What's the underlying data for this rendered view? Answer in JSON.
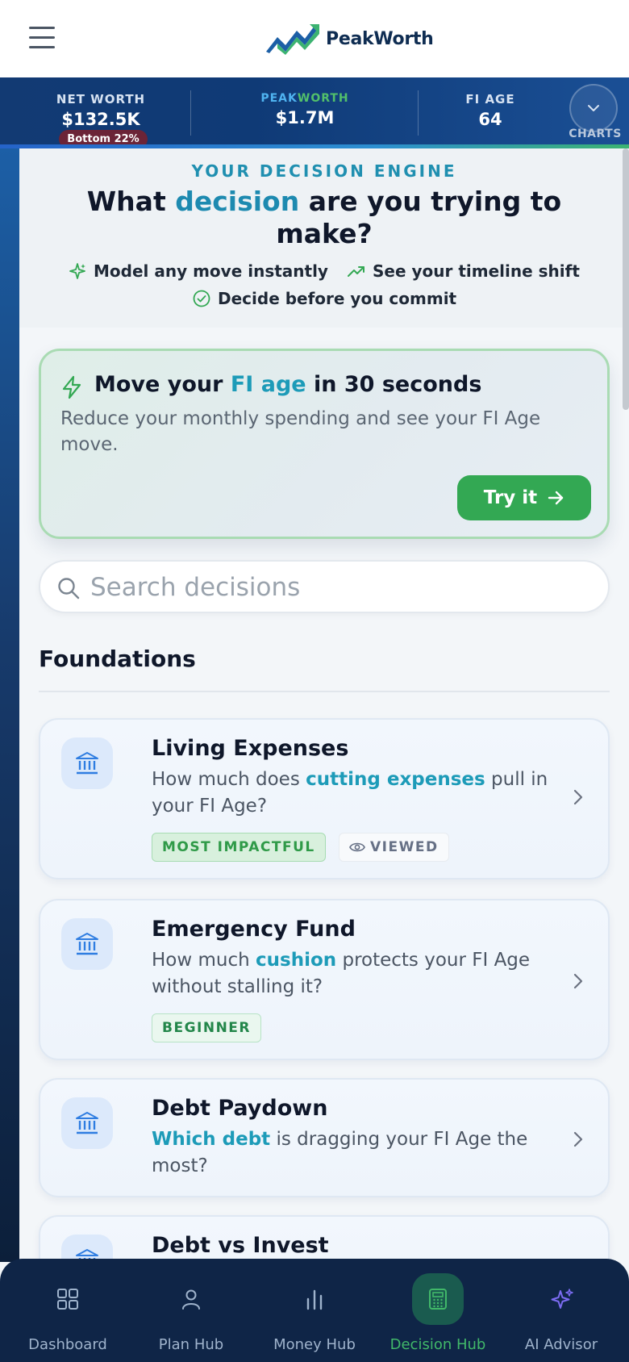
{
  "header": {
    "brand": "PeakWorth"
  },
  "stats": {
    "net_worth_label": "NET WORTH",
    "net_worth_value": "$132.5K",
    "net_worth_badge": "Bottom 22%",
    "peakworth_label_peak": "PEAK",
    "peakworth_label_worth": "WORTH",
    "peakworth_value": "$1.7M",
    "fi_age_label": "FI AGE",
    "fi_age_value": "64",
    "charts_label": "CHARTS"
  },
  "hero": {
    "eyebrow": "YOUR DECISION ENGINE",
    "headline_pre": "What ",
    "headline_accent": "decision",
    "headline_post": " are you trying to make?",
    "features": [
      "Model any move instantly",
      "See your timeline shift",
      "Decide before you commit"
    ]
  },
  "promo": {
    "title_pre": "Move your ",
    "title_accent": "FI age",
    "title_post": " in 30 seconds",
    "description": "Reduce your monthly spending and see your FI Age move.",
    "button_label": "Try it"
  },
  "search": {
    "placeholder": "Search decisions"
  },
  "section": {
    "title": "Foundations"
  },
  "cards": [
    {
      "title": "Living Expenses",
      "desc_pre": "How much does ",
      "desc_hl": "cutting expenses",
      "desc_post": " pull in your FI Age?",
      "tags": [
        "MOST IMPACTFUL",
        "VIEWED"
      ]
    },
    {
      "title": "Emergency Fund",
      "desc_pre": "How much ",
      "desc_hl": "cushion",
      "desc_post": " protects your FI Age without stalling it?",
      "tags": [
        "BEGINNER"
      ]
    },
    {
      "title": "Debt Paydown",
      "desc_pre": "",
      "desc_hl": "Which debt",
      "desc_post": " is dragging your FI Age the most?",
      "tags": []
    },
    {
      "title": "Debt vs Invest",
      "desc_pre": "",
      "desc_hl": "",
      "desc_post": "",
      "tags": []
    }
  ],
  "nav": {
    "items": [
      "Dashboard",
      "Plan Hub",
      "Money Hub",
      "Decision Hub",
      "AI Advisor"
    ],
    "active": "Decision Hub"
  },
  "colors": {
    "brand_navy": "#0f2d52",
    "accent_teal": "#1d9bb8",
    "accent_green": "#33a853",
    "nav_bg": "#0f2547"
  }
}
